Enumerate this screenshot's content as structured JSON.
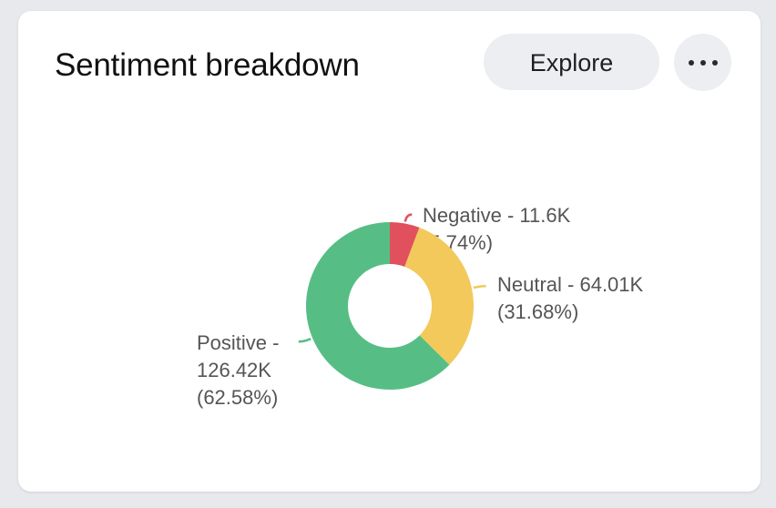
{
  "header": {
    "title": "Sentiment breakdown",
    "explore_label": "Explore",
    "more_icon": "more-horizontal-icon"
  },
  "chart_data": {
    "type": "pie",
    "title": "Sentiment breakdown",
    "donut": true,
    "start_angle_deg": 0,
    "slices": [
      {
        "name": "Negative",
        "value": 11.6,
        "value_label": "11.6K",
        "percent_label": "5.74%",
        "color": "#e0515d"
      },
      {
        "name": "Neutral",
        "value": 64.01,
        "value_label": "64.01K",
        "percent_label": "31.68%",
        "color": "#f2c95a"
      },
      {
        "name": "Positive",
        "value": 126.42,
        "value_label": "126.42K",
        "percent_label": "62.58%",
        "color": "#56be85"
      }
    ]
  }
}
